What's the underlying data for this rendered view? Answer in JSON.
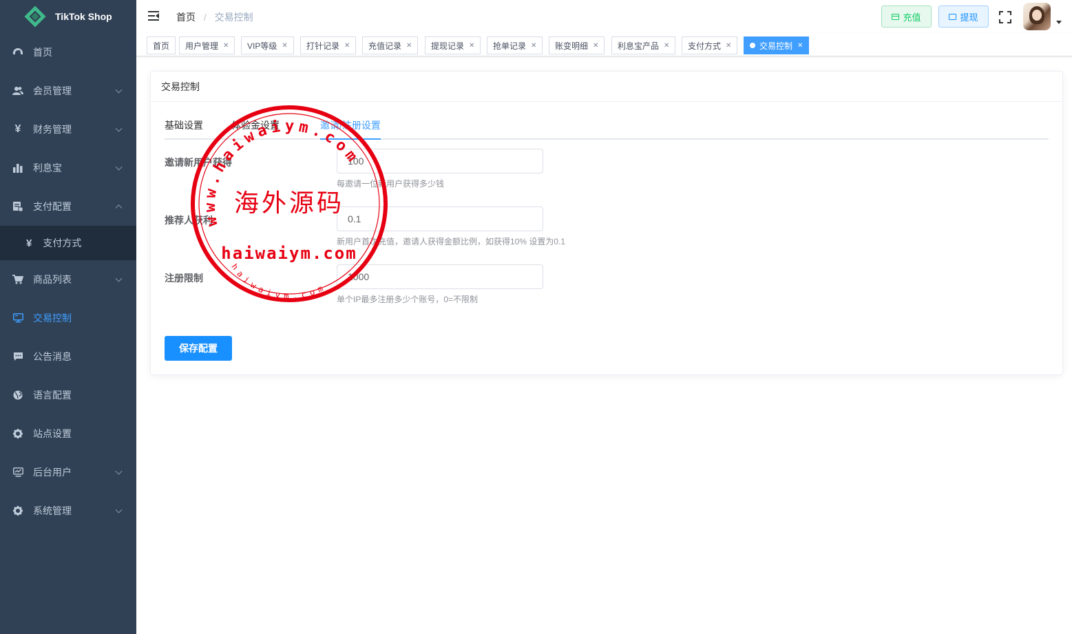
{
  "brand": {
    "name": "TikTok Shop"
  },
  "sidebar": {
    "items": [
      {
        "label": "首页",
        "icon": "dashboard-icon",
        "has_arrow": false
      },
      {
        "label": "会员管理",
        "icon": "users-icon",
        "has_arrow": true
      },
      {
        "label": "财务管理",
        "icon": "yen-icon",
        "has_arrow": true
      },
      {
        "label": "利息宝",
        "icon": "bar-chart-icon",
        "has_arrow": true
      },
      {
        "label": "支付配置",
        "icon": "payment-config-icon",
        "has_arrow": true,
        "expanded": true
      },
      {
        "label": "支付方式",
        "icon": "yen-icon",
        "submenu": true
      },
      {
        "label": "商品列表",
        "icon": "cart-icon",
        "has_arrow": true
      },
      {
        "label": "交易控制",
        "icon": "monitor-icon",
        "has_arrow": false,
        "active": true
      },
      {
        "label": "公告消息",
        "icon": "message-icon",
        "has_arrow": false
      },
      {
        "label": "语言配置",
        "icon": "globe-icon",
        "has_arrow": false
      },
      {
        "label": "站点设置",
        "icon": "gear-icon",
        "has_arrow": false
      },
      {
        "label": "后台用户",
        "icon": "monitor-chart-icon",
        "has_arrow": true
      },
      {
        "label": "系统管理",
        "icon": "gear-icon",
        "has_arrow": true
      }
    ]
  },
  "header": {
    "breadcrumb": {
      "home": "首页",
      "separator": "/",
      "current": "交易控制"
    },
    "recharge_label": "充值",
    "withdraw_label": "提现"
  },
  "tags": [
    {
      "label": "首页",
      "closable": false
    },
    {
      "label": "用户管理",
      "closable": true
    },
    {
      "label": "VIP等级",
      "closable": true
    },
    {
      "label": "打针记录",
      "closable": true
    },
    {
      "label": "充值记录",
      "closable": true
    },
    {
      "label": "提现记录",
      "closable": true
    },
    {
      "label": "抢单记录",
      "closable": true
    },
    {
      "label": "账变明细",
      "closable": true
    },
    {
      "label": "利息宝产品",
      "closable": true
    },
    {
      "label": "支付方式",
      "closable": true
    },
    {
      "label": "交易控制",
      "closable": true,
      "active": true
    }
  ],
  "card": {
    "title": "交易控制",
    "tabs": [
      {
        "label": "基础设置",
        "active": false
      },
      {
        "label": "体验金设置",
        "active": false
      },
      {
        "label": "邀请/注册设置",
        "active": true
      }
    ],
    "form": {
      "invite_reward": {
        "label": "邀请新用户获得",
        "value": "100",
        "hint": "每邀请一位新用户获得多少钱"
      },
      "referrer_profit": {
        "label": "推荐人获利",
        "value": "0.1",
        "hint": "新用户首次充值，邀请人获得金额比例，如获得10% 设置为0.1"
      },
      "register_limit": {
        "label": "注册限制",
        "value": "1000",
        "hint": "单个IP最多注册多少个账号，0=不限制"
      }
    },
    "save_label": "保存配置"
  },
  "watermark": {
    "center_text": "海外源码",
    "arc_text": "www.haiwaiym.com",
    "domain_text": "haiwaiym.com",
    "small_text": "haiwaiym.com",
    "color": "#e60012"
  },
  "colors": {
    "sidebar_bg": "#304156",
    "accent": "#409eff",
    "primary_button": "#1890ff",
    "success": "#13ce66"
  }
}
